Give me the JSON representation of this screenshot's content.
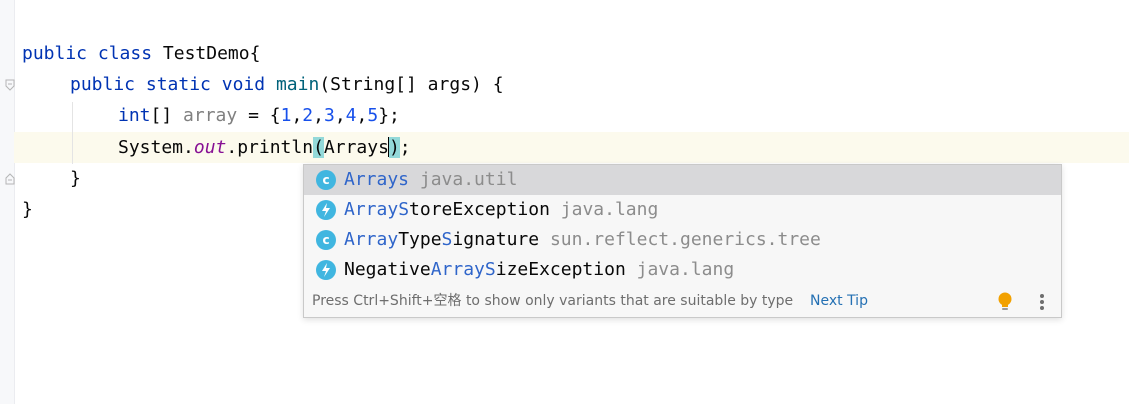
{
  "editor": {
    "code": {
      "l1": {
        "kw1": "public",
        "kw2": "class",
        "name": "TestDemo{"
      },
      "l2": {
        "kw1": "public",
        "kw2": "static",
        "kw3": "void",
        "fn": "main",
        "rest": "(String[] args) {"
      },
      "l3": {
        "type": "int",
        "brackets": "[]",
        "var": "array",
        "eq": " = {",
        "n1": "1",
        "n2": "2",
        "n3": "3",
        "n4": "4",
        "n5": "5",
        "end": "};",
        "comma": ","
      },
      "l4": {
        "obj": "System.",
        "field": "out",
        "call": ".println",
        "lparen": "(",
        "arg": "Arrays",
        "rparen": ")",
        "semi": ";"
      },
      "l5": {
        "text": "}"
      },
      "l6": {
        "text": "}"
      }
    }
  },
  "completion": {
    "items": [
      {
        "icon": "class-icon",
        "letter": "c",
        "match1": "Arrays",
        "plain1": "",
        "match2": "",
        "plain2": "",
        "pkg": "java.util"
      },
      {
        "icon": "exception-icon",
        "letter": "",
        "match1": "Array",
        "plain1": "",
        "match2": "S",
        "plain2": "toreException",
        "pkg": "java.lang"
      },
      {
        "icon": "class-icon",
        "letter": "c",
        "match1": "Array",
        "plain1": "Type",
        "match2": "S",
        "plain2": "ignature",
        "pkg": "sun.reflect.generics.tree"
      },
      {
        "icon": "exception-icon",
        "letter": "",
        "prefix": "Negative",
        "match1": "Array",
        "match2": "S",
        "plain2": "izeException",
        "pkg": "java.lang"
      }
    ],
    "footer": {
      "hint": "Press Ctrl+Shift+空格 to show only variants that are suitable by type",
      "next_tip": "Next Tip"
    }
  },
  "colors": {
    "keyword": "#0033b3",
    "match": "#2f65ca",
    "class_icon": "#40b6e0",
    "exception_icon": "#40b6e0",
    "bulb": "#f2a100"
  }
}
